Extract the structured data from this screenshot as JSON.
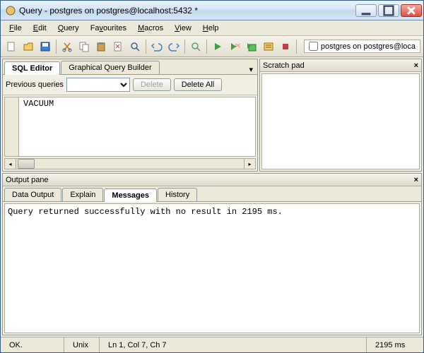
{
  "window": {
    "title": "Query - postgres on postgres@localhost:5432 *"
  },
  "menu": {
    "file": "File",
    "edit": "Edit",
    "query": "Query",
    "favourites": "Favourites",
    "macros": "Macros",
    "view": "View",
    "help": "Help"
  },
  "connection_label": "postgres on postgres@loca",
  "editor": {
    "tabs": {
      "sql": "SQL Editor",
      "graphical": "Graphical Query Builder"
    },
    "prev_label": "Previous queries",
    "delete_btn": "Delete",
    "delete_all_btn": "Delete All",
    "content": "VACUUM"
  },
  "scratch": {
    "title": "Scratch pad"
  },
  "output": {
    "title": "Output pane",
    "tabs": {
      "data": "Data Output",
      "explain": "Explain",
      "messages": "Messages",
      "history": "History"
    },
    "message": "Query returned successfully with no result in 2195 ms."
  },
  "status": {
    "ok": "OK.",
    "mode": "Unix",
    "pos": "Ln 1, Col 7, Ch 7",
    "time": "2195 ms"
  }
}
